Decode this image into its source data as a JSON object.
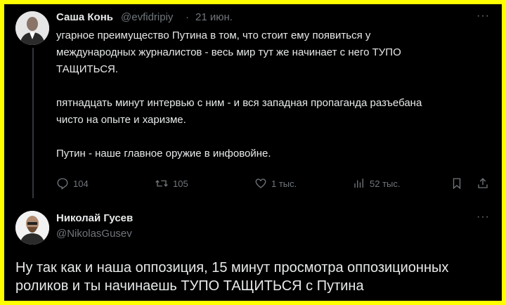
{
  "tweet1": {
    "author_name": "Саша Конь",
    "handle": "@evfidripiy",
    "separator": "·",
    "date": "21 июн.",
    "more": "···",
    "lines": [
      "угарное преимущество Путина в том, что стоит ему появиться у",
      "международных журналистов - весь мир тут же начинает с него ТУПО",
      "ТАЩИТЬСЯ.",
      "пятнадцать минут интервью с ним - и вся западная пропаганда разъебана",
      "чисто на опыте и харизме.",
      "Путин - наше главное оружие в инфовойне."
    ],
    "actions": {
      "replies": "104",
      "retweets": "105",
      "likes": "1 тыс.",
      "views": "52 тыс."
    }
  },
  "tweet2": {
    "author_name": "Николай Гусев",
    "handle": "@NikolasGusev",
    "more": "···",
    "lines": [
      "Ну так как и наша оппозиция, 15 минут просмотра оппозиционных",
      "роликов и ты начинаешь ТУПО ТАЩИТЬСЯ с Путина"
    ]
  },
  "colors": {
    "frame_border": "#ffff00",
    "background": "#000000",
    "text": "#e7e9ea",
    "muted": "#71767b"
  },
  "icons": [
    "reply-icon",
    "retweet-icon",
    "like-icon",
    "views-icon",
    "bookmark-icon",
    "share-icon"
  ]
}
